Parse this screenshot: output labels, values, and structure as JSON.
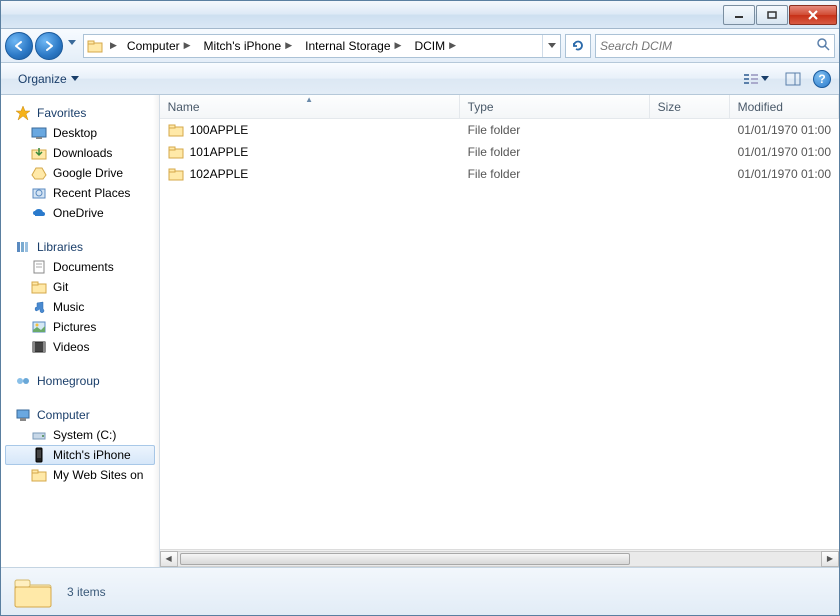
{
  "breadcrumb": {
    "items": [
      "Computer",
      "Mitch's iPhone",
      "Internal Storage",
      "DCIM"
    ]
  },
  "search": {
    "placeholder": "Search DCIM"
  },
  "toolbar": {
    "organize_label": "Organize"
  },
  "sidebar": {
    "favorites": {
      "label": "Favorites",
      "items": [
        {
          "label": "Desktop",
          "icon": "desktop"
        },
        {
          "label": "Downloads",
          "icon": "downloads"
        },
        {
          "label": "Google Drive",
          "icon": "gdrive"
        },
        {
          "label": "Recent Places",
          "icon": "recent"
        },
        {
          "label": "OneDrive",
          "icon": "onedrive"
        }
      ]
    },
    "libraries": {
      "label": "Libraries",
      "items": [
        {
          "label": "Documents",
          "icon": "documents"
        },
        {
          "label": "Git",
          "icon": "git"
        },
        {
          "label": "Music",
          "icon": "music"
        },
        {
          "label": "Pictures",
          "icon": "pictures"
        },
        {
          "label": "Videos",
          "icon": "videos"
        }
      ]
    },
    "homegroup": {
      "label": "Homegroup"
    },
    "computer": {
      "label": "Computer",
      "items": [
        {
          "label": "System (C:)",
          "icon": "drive"
        },
        {
          "label": "Mitch's iPhone",
          "icon": "iphone",
          "selected": true
        },
        {
          "label": "My Web Sites on",
          "icon": "folder"
        }
      ]
    }
  },
  "columns": {
    "name": "Name",
    "type": "Type",
    "size": "Size",
    "modified": "Modified"
  },
  "files": [
    {
      "name": "100APPLE",
      "type": "File folder",
      "size": "",
      "modified": "01/01/1970 01:00"
    },
    {
      "name": "101APPLE",
      "type": "File folder",
      "size": "",
      "modified": "01/01/1970 01:00"
    },
    {
      "name": "102APPLE",
      "type": "File folder",
      "size": "",
      "modified": "01/01/1970 01:00"
    }
  ],
  "status": {
    "text": "3 items"
  }
}
